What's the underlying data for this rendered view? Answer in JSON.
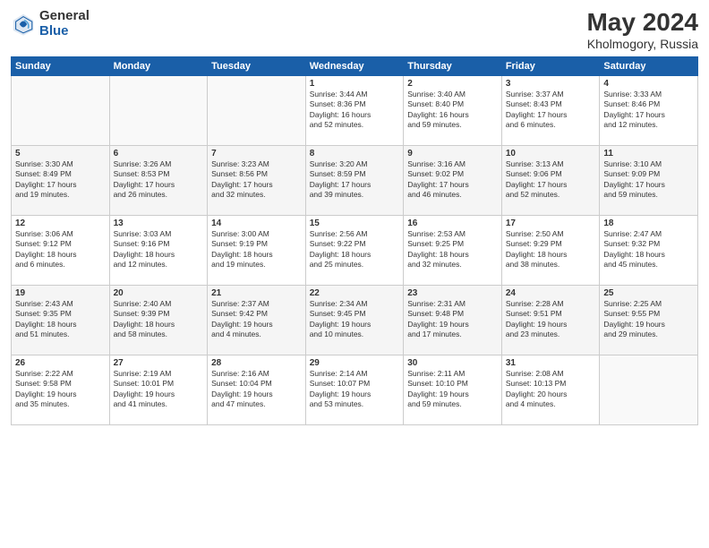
{
  "logo": {
    "general": "General",
    "blue": "Blue"
  },
  "title": "May 2024",
  "subtitle": "Kholmogory, Russia",
  "days_header": [
    "Sunday",
    "Monday",
    "Tuesday",
    "Wednesday",
    "Thursday",
    "Friday",
    "Saturday"
  ],
  "weeks": [
    [
      {
        "day": "",
        "info": ""
      },
      {
        "day": "",
        "info": ""
      },
      {
        "day": "",
        "info": ""
      },
      {
        "day": "1",
        "info": "Sunrise: 3:44 AM\nSunset: 8:36 PM\nDaylight: 16 hours\nand 52 minutes."
      },
      {
        "day": "2",
        "info": "Sunrise: 3:40 AM\nSunset: 8:40 PM\nDaylight: 16 hours\nand 59 minutes."
      },
      {
        "day": "3",
        "info": "Sunrise: 3:37 AM\nSunset: 8:43 PM\nDaylight: 17 hours\nand 6 minutes."
      },
      {
        "day": "4",
        "info": "Sunrise: 3:33 AM\nSunset: 8:46 PM\nDaylight: 17 hours\nand 12 minutes."
      }
    ],
    [
      {
        "day": "5",
        "info": "Sunrise: 3:30 AM\nSunset: 8:49 PM\nDaylight: 17 hours\nand 19 minutes."
      },
      {
        "day": "6",
        "info": "Sunrise: 3:26 AM\nSunset: 8:53 PM\nDaylight: 17 hours\nand 26 minutes."
      },
      {
        "day": "7",
        "info": "Sunrise: 3:23 AM\nSunset: 8:56 PM\nDaylight: 17 hours\nand 32 minutes."
      },
      {
        "day": "8",
        "info": "Sunrise: 3:20 AM\nSunset: 8:59 PM\nDaylight: 17 hours\nand 39 minutes."
      },
      {
        "day": "9",
        "info": "Sunrise: 3:16 AM\nSunset: 9:02 PM\nDaylight: 17 hours\nand 46 minutes."
      },
      {
        "day": "10",
        "info": "Sunrise: 3:13 AM\nSunset: 9:06 PM\nDaylight: 17 hours\nand 52 minutes."
      },
      {
        "day": "11",
        "info": "Sunrise: 3:10 AM\nSunset: 9:09 PM\nDaylight: 17 hours\nand 59 minutes."
      }
    ],
    [
      {
        "day": "12",
        "info": "Sunrise: 3:06 AM\nSunset: 9:12 PM\nDaylight: 18 hours\nand 6 minutes."
      },
      {
        "day": "13",
        "info": "Sunrise: 3:03 AM\nSunset: 9:16 PM\nDaylight: 18 hours\nand 12 minutes."
      },
      {
        "day": "14",
        "info": "Sunrise: 3:00 AM\nSunset: 9:19 PM\nDaylight: 18 hours\nand 19 minutes."
      },
      {
        "day": "15",
        "info": "Sunrise: 2:56 AM\nSunset: 9:22 PM\nDaylight: 18 hours\nand 25 minutes."
      },
      {
        "day": "16",
        "info": "Sunrise: 2:53 AM\nSunset: 9:25 PM\nDaylight: 18 hours\nand 32 minutes."
      },
      {
        "day": "17",
        "info": "Sunrise: 2:50 AM\nSunset: 9:29 PM\nDaylight: 18 hours\nand 38 minutes."
      },
      {
        "day": "18",
        "info": "Sunrise: 2:47 AM\nSunset: 9:32 PM\nDaylight: 18 hours\nand 45 minutes."
      }
    ],
    [
      {
        "day": "19",
        "info": "Sunrise: 2:43 AM\nSunset: 9:35 PM\nDaylight: 18 hours\nand 51 minutes."
      },
      {
        "day": "20",
        "info": "Sunrise: 2:40 AM\nSunset: 9:39 PM\nDaylight: 18 hours\nand 58 minutes."
      },
      {
        "day": "21",
        "info": "Sunrise: 2:37 AM\nSunset: 9:42 PM\nDaylight: 19 hours\nand 4 minutes."
      },
      {
        "day": "22",
        "info": "Sunrise: 2:34 AM\nSunset: 9:45 PM\nDaylight: 19 hours\nand 10 minutes."
      },
      {
        "day": "23",
        "info": "Sunrise: 2:31 AM\nSunset: 9:48 PM\nDaylight: 19 hours\nand 17 minutes."
      },
      {
        "day": "24",
        "info": "Sunrise: 2:28 AM\nSunset: 9:51 PM\nDaylight: 19 hours\nand 23 minutes."
      },
      {
        "day": "25",
        "info": "Sunrise: 2:25 AM\nSunset: 9:55 PM\nDaylight: 19 hours\nand 29 minutes."
      }
    ],
    [
      {
        "day": "26",
        "info": "Sunrise: 2:22 AM\nSunset: 9:58 PM\nDaylight: 19 hours\nand 35 minutes."
      },
      {
        "day": "27",
        "info": "Sunrise: 2:19 AM\nSunset: 10:01 PM\nDaylight: 19 hours\nand 41 minutes."
      },
      {
        "day": "28",
        "info": "Sunrise: 2:16 AM\nSunset: 10:04 PM\nDaylight: 19 hours\nand 47 minutes."
      },
      {
        "day": "29",
        "info": "Sunrise: 2:14 AM\nSunset: 10:07 PM\nDaylight: 19 hours\nand 53 minutes."
      },
      {
        "day": "30",
        "info": "Sunrise: 2:11 AM\nSunset: 10:10 PM\nDaylight: 19 hours\nand 59 minutes."
      },
      {
        "day": "31",
        "info": "Sunrise: 2:08 AM\nSunset: 10:13 PM\nDaylight: 20 hours\nand 4 minutes."
      },
      {
        "day": "",
        "info": ""
      }
    ]
  ]
}
